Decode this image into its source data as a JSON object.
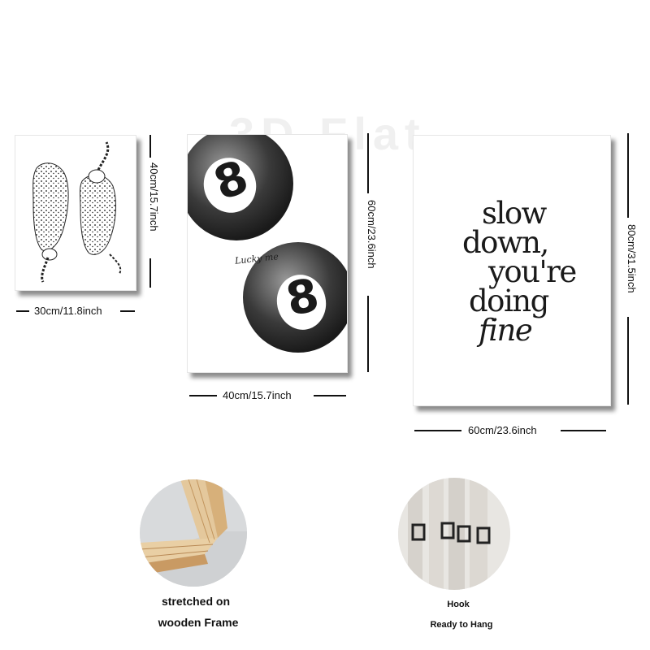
{
  "watermark": "3D Flat",
  "posters": {
    "small": {
      "width_label": "30cm/11.8inch",
      "height_label": "40cm/15.7inch"
    },
    "medium": {
      "width_label": "40cm/15.7inch",
      "height_label": "60cm/23.6inch",
      "script_text": "Lucky me",
      "ball_number": "8"
    },
    "large": {
      "width_label": "60cm/23.6inch",
      "height_label": "80cm/31.5inch",
      "quote_lines": [
        "slow",
        "down,",
        "you're",
        "doing",
        "fine"
      ]
    }
  },
  "features": {
    "frame": {
      "caption_line1": "stretched on",
      "caption_line2": "wooden Frame"
    },
    "hook": {
      "caption_line1": "Hook",
      "caption_line2": "Ready to Hang"
    }
  }
}
